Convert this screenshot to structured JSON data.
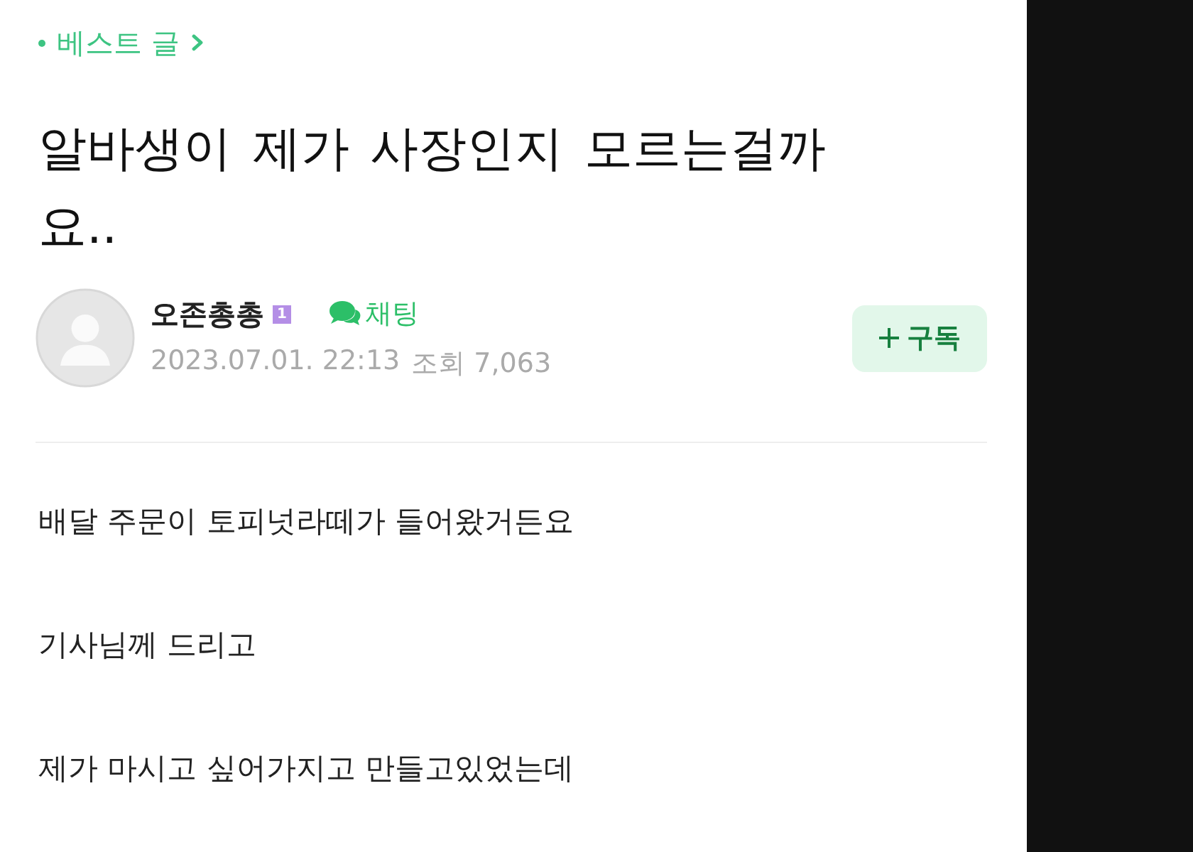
{
  "breadcrumb": {
    "label": "베스트 글"
  },
  "title": "알바생이 제가 사장인지 모르는걸까요..",
  "author": {
    "name": "오존총총",
    "level_badge": "1",
    "chat_label": "채팅",
    "date": "2023.07.01. 22:13",
    "views_label": "조회",
    "views": "7,063"
  },
  "subscribe_button": {
    "label": "구독"
  },
  "body": [
    "배달 주문이 토피넛라떼가 들어왔거든요",
    "기사님께 드리고",
    "제가 마시고 싶어가지고 만들고있었는데"
  ]
}
